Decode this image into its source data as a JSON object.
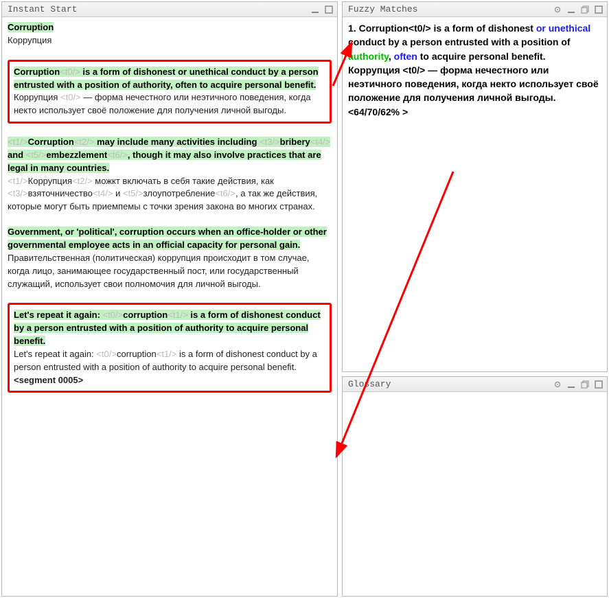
{
  "panels": {
    "instant_start": {
      "title": "Instant Start"
    },
    "fuzzy": {
      "title": "Fuzzy Matches"
    },
    "glossary": {
      "title": "Glossary"
    }
  },
  "segments": [
    {
      "src": "Corruption",
      "trg": "Коррупция"
    },
    {
      "framed": true,
      "src_parts": [
        {
          "t": "Corruption",
          "g": 1
        },
        {
          "t": "<t0/>",
          "tag": 1,
          "g": 1
        },
        {
          "t": " is a form of dishonest or unethical conduct by a person entrusted with a position of authority, often to acquire personal benefit.",
          "g": 1
        }
      ],
      "trg_parts": [
        {
          "t": "Коррупция "
        },
        {
          "t": "<t0/>",
          "tag": 1
        },
        {
          "t": " — форма нечестного или неэтичного поведения, когда некто использует своё положение для получения личной выгоды."
        }
      ]
    },
    {
      "src_parts": [
        {
          "t": "<t1/>",
          "tag": 1,
          "g": 1
        },
        {
          "t": "Corruption",
          "g": 1
        },
        {
          "t": "<t2/>",
          "tag": 1,
          "g": 1
        },
        {
          "t": " may include many activities including ",
          "g": 1
        },
        {
          "t": "<t3/>",
          "tag": 1,
          "g": 1
        },
        {
          "t": "bribery",
          "g": 1
        },
        {
          "t": "<t4/>",
          "tag": 1,
          "g": 1
        },
        {
          "t": " and ",
          "g": 1
        },
        {
          "t": "<t5/>",
          "tag": 1,
          "g": 1
        },
        {
          "t": "embezzlement",
          "g": 1
        },
        {
          "t": "<t6/>",
          "tag": 1,
          "g": 1
        },
        {
          "t": ", though it may also involve practices that are legal in many countries.",
          "g": 1
        }
      ],
      "trg_parts": [
        {
          "t": "<t1/>",
          "tag": 1
        },
        {
          "t": "Коррупция"
        },
        {
          "t": "<t2/>",
          "tag": 1
        },
        {
          "t": " можкт включать в себя такие действия, как "
        },
        {
          "t": "<t3/>",
          "tag": 1
        },
        {
          "t": "взяточничество"
        },
        {
          "t": "<t4/>",
          "tag": 1
        },
        {
          "t": " и "
        },
        {
          "t": "<t5/>",
          "tag": 1
        },
        {
          "t": "злоупотребление"
        },
        {
          "t": "<t6/>",
          "tag": 1
        },
        {
          "t": ", а так же действия, которые могут быть приемпемы с точки зрения закона во многих странах."
        }
      ]
    },
    {
      "src_parts": [
        {
          "t": "Government, or 'political', corruption occurs when an office-holder or other governmental employee acts in an official capacity for personal gain.",
          "g": 1
        }
      ],
      "trg_parts": [
        {
          "t": "Правительственная (политическая) коррупция происходит в том случае, когда лицо, занимающее государственный пост, или государственный служащий, использует свои полномочия для личной выгоды."
        }
      ]
    },
    {
      "framed": true,
      "src_parts": [
        {
          "t": "Let's repeat it again: ",
          "g": 1
        },
        {
          "t": "<t0/>",
          "tag": 1,
          "g": 1
        },
        {
          "t": "corruption",
          "g": 1
        },
        {
          "t": "<t1/>",
          "tag": 1,
          "g": 1
        },
        {
          "t": " is a form of dishonest conduct by a person entrusted with a position of authority to acquire personal benefit.",
          "g": 1
        }
      ],
      "trg_parts": [
        {
          "t": "Let's repeat it again: "
        },
        {
          "t": "<t0/>",
          "tag": 1
        },
        {
          "t": "corruption"
        },
        {
          "t": "<t1/>",
          "tag": 1
        },
        {
          "t": " is a form of dishonest conduct by a person entrusted with a position of authority to acquire personal benefit."
        },
        {
          "t": "<segment 0005>",
          "seg": 1
        }
      ]
    }
  ],
  "fuzzy": {
    "num": "1. ",
    "src_pre": "Corruption<t0/> is a form of dishonest ",
    "or": "or",
    "mid1": " ",
    "unethical": "unethical",
    "mid2": " conduct by a person entrusted with a position of ",
    "authority": "authority",
    "comma": ", ",
    "often": "often",
    "tail": " to acquire personal benefit.",
    "trg": "Коррупция <t0/> — форма нечестного или неэтичного поведения, когда некто использует своё положение для получения личной выгоды.",
    "score": "<64/70/62% >"
  }
}
